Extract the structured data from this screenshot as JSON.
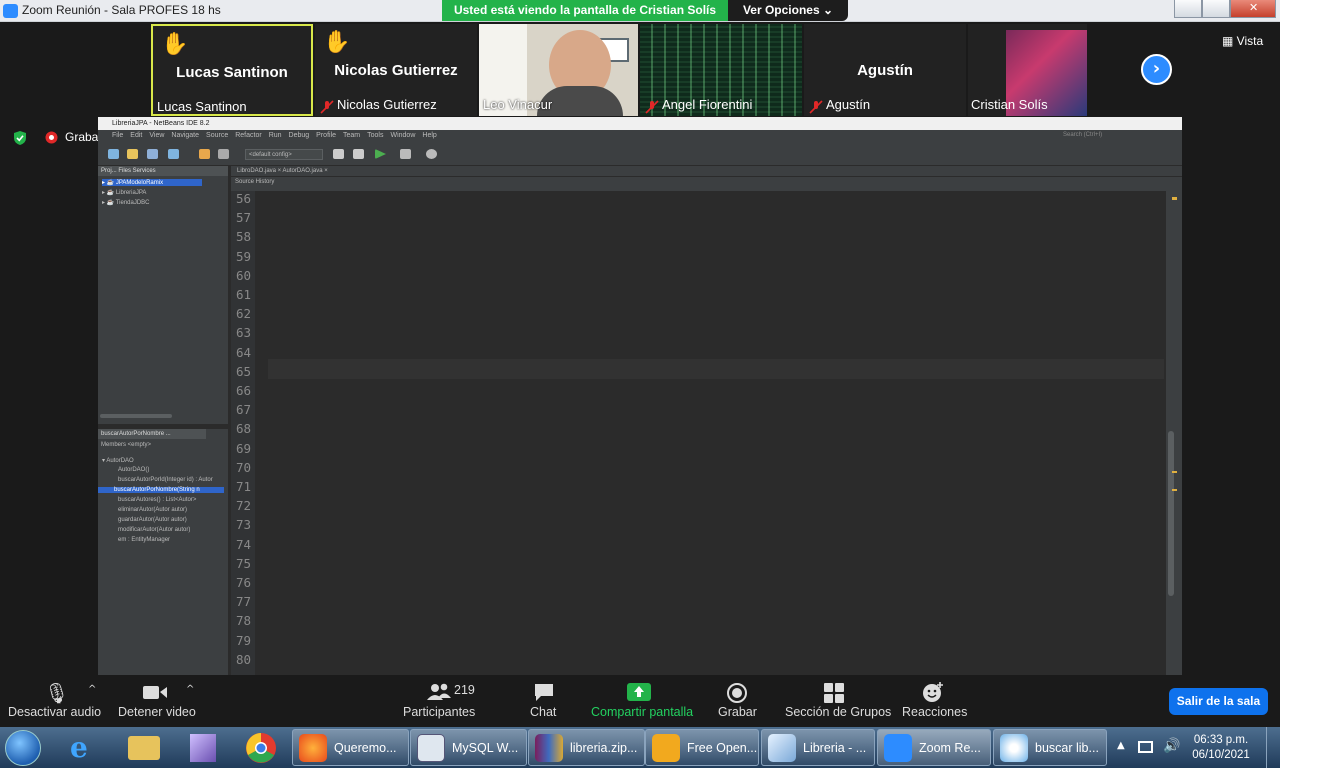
{
  "window": {
    "title": "Zoom Reunión - Sala PROFES 18 hs"
  },
  "banner": {
    "sharing": "Usted está viendo la pantalla de Cristian Solís",
    "options": "Ver Opciones"
  },
  "participants": [
    {
      "display": "Lucas Santinon",
      "label": "Lucas Santinon"
    },
    {
      "display": "Nicolas Gutierrez",
      "label": "Nicolas Gutierrez"
    },
    {
      "label": "Leo Vinacur"
    },
    {
      "label": "Angel Fiorentini"
    },
    {
      "display": "Agustín",
      "label": "Agustín"
    },
    {
      "label": "Cristian Solís"
    }
  ],
  "view": {
    "label": "Vista"
  },
  "recording": {
    "label": "Grabando"
  },
  "netbeans": {
    "title": "LibreriaJPA - NetBeans IDE 8.2",
    "menu": [
      "File",
      "Edit",
      "View",
      "Navigate",
      "Source",
      "Refactor",
      "Run",
      "Debug",
      "Profile",
      "Team",
      "Tools",
      "Window",
      "Help"
    ],
    "config": "<default config>",
    "search_placeholder": "Search (Ctrl+I)",
    "panel_tabs": "Proj...   Files    Services",
    "projects": [
      "JPAModeloRamix",
      "LibreriaJPA",
      "TiendaJDBC"
    ],
    "navigator_title": "buscarAutorPorNombre ...",
    "navigator_filter": "Members      <empty>",
    "navigator": [
      "AutorDAO",
      "AutorDAO()",
      "buscarAutorPorId(Integer id) : Autor",
      "buscarAutorPorNombre(String n",
      "buscarAutores() : List<Autor>",
      "eliminarAutor(Autor autor)",
      "guardarAutor(Autor autor)",
      "modificarAutor(Autor autor)",
      "em : EntityManager"
    ],
    "tabs": "LibroDAO.java  ×      AutorDAO.java  ×",
    "source_tabs": "Source    History"
  },
  "code": {
    "numbers": [
      "56",
      "57",
      "58",
      "59",
      "60",
      "61",
      "62",
      "63",
      "64",
      "65",
      "66",
      "67",
      "68",
      "69",
      "70",
      "71",
      "72",
      "73",
      "74",
      "75",
      "76",
      "77",
      "78",
      "79",
      "80"
    ]
  },
  "controls": {
    "audio": "Desactivar audio",
    "video": "Detener video",
    "participants": "Participantes",
    "participants_count": "219",
    "chat": "Chat",
    "share": "Compartir pantalla",
    "record": "Grabar",
    "breakout": "Sección de Grupos",
    "reactions": "Reacciones",
    "leave": "Salir de la sala"
  },
  "taskbar": {
    "items": [
      "Queremo...",
      "MySQL W...",
      "libreria.zip...",
      "Free Open...",
      "Libreria - ...",
      "Zoom Re...",
      "buscar lib..."
    ],
    "time": "06:33 p.m.",
    "date": "06/10/2021"
  },
  "colors": {
    "zoom_blue": "#2d8cff",
    "share_green": "#23b34a",
    "leave_blue": "#0e72ed",
    "editor_bg": "#2b2b2b"
  }
}
